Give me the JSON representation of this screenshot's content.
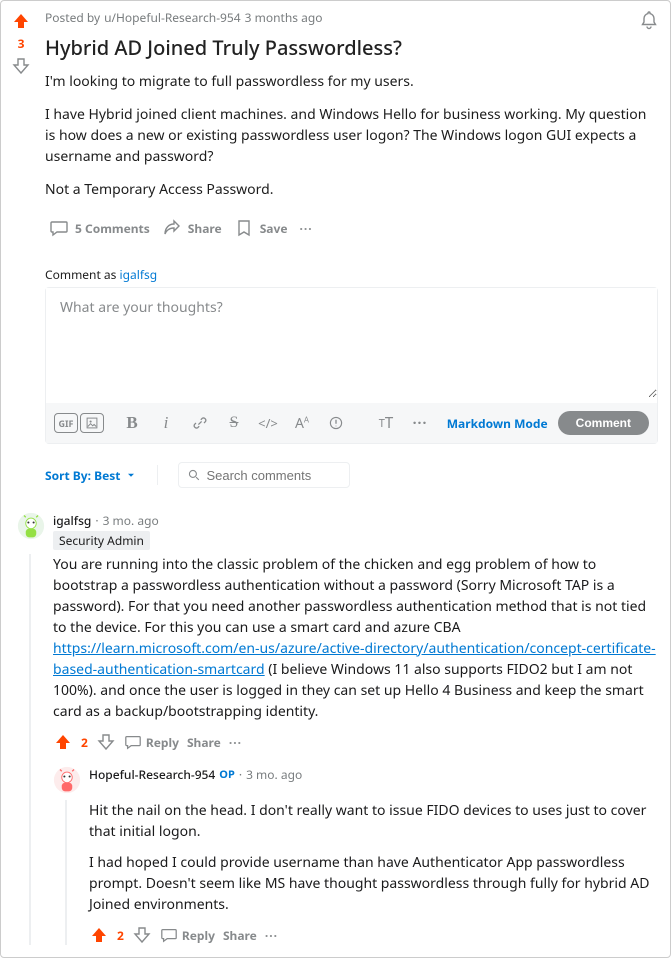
{
  "post": {
    "posted_by_prefix": "Posted by",
    "author": "u/Hopeful-Research-954",
    "age": "3 months ago",
    "score": "3",
    "title": "Hybrid AD Joined Truly Passwordless?",
    "paragraphs": [
      "I'm looking to migrate to full passwordless for my users.",
      "I have Hybrid joined client machines. and Windows Hello for business working. My question is how does a new or existing passwordless user logon? The Windows logon GUI expects a username and password?",
      "Not a Temporary Access Password."
    ]
  },
  "actions": {
    "comments": "5 Comments",
    "share": "Share",
    "save": "Save"
  },
  "editor": {
    "comment_as": "Comment as",
    "user": "igalfsg",
    "placeholder": "What are your thoughts?",
    "markdown_mode": "Markdown Mode",
    "comment_btn": "Comment"
  },
  "sort": {
    "label": "Sort By: Best",
    "search_placeholder": "Search comments"
  },
  "comments": [
    {
      "author": "igalfsg",
      "age": "3 mo. ago",
      "flair": "Security Admin",
      "body_before_link": "You are running into the classic problem of the chicken and egg problem of how to bootstrap a passwordless authentication without a password (Sorry Microsoft TAP is a password). For that you need another passwordless authentication method that is not tied to the device. For this you can use a smart card and azure CBA ",
      "link_text": "https://learn.microsoft.com/en-us/azure/active-directory/authentication/concept-certificate-based-authentication-smartcard",
      "body_after_link": " (I believe Windows 11 also supports FIDO2 but I am not 100%). and once the user is logged in they can set up Hello 4 Business and keep the smart card as a backup/bootstrapping identity.",
      "score": "2",
      "reply": "Reply",
      "share": "Share",
      "children": [
        {
          "author": "Hopeful-Research-954",
          "op": "OP",
          "age": "3 mo. ago",
          "paragraphs": [
            "Hit the nail on the head. I don't really want to issue FIDO devices to uses just to cover that initial logon.",
            "I had hoped I could provide username than have Authenticator App passwordless prompt. Doesn't seem like MS have thought passwordless through fully for hybrid AD Joined environments."
          ],
          "score": "2",
          "reply": "Reply",
          "share": "Share"
        }
      ]
    }
  ]
}
